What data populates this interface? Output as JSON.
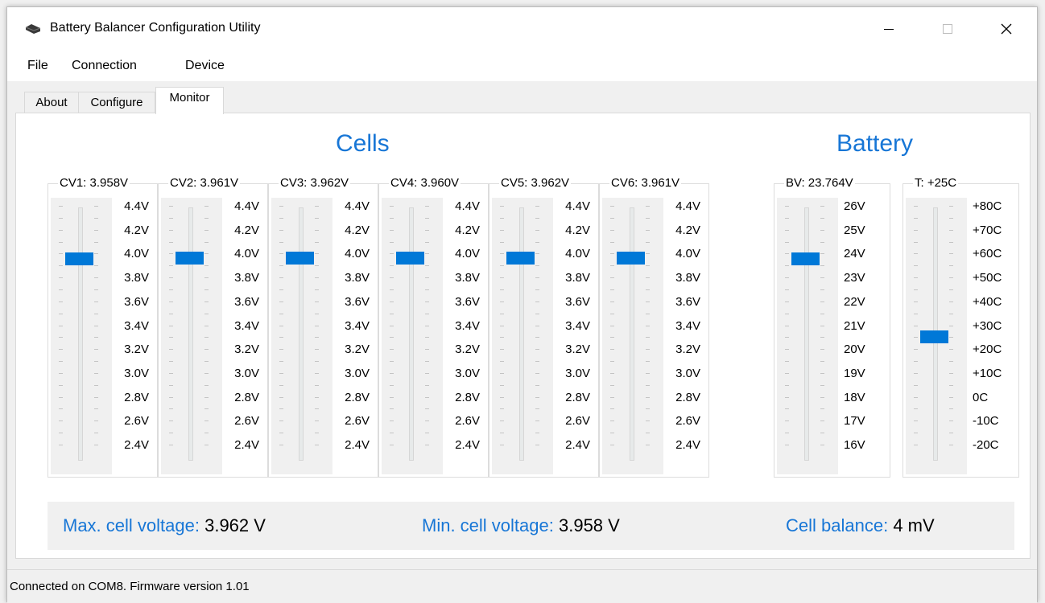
{
  "window": {
    "title": "Battery Balancer Configuration Utility",
    "icon": "battery-icon"
  },
  "menu": {
    "items": [
      "File",
      "Connection",
      "Device"
    ]
  },
  "tabs": [
    {
      "label": "About",
      "active": false
    },
    {
      "label": "Configure",
      "active": false
    },
    {
      "label": "Monitor",
      "active": true
    }
  ],
  "monitor": {
    "cells_title": "Cells",
    "battery_title": "Battery",
    "cell_scale": [
      "4.4V",
      "4.2V",
      "4.0V",
      "3.8V",
      "3.6V",
      "3.4V",
      "3.2V",
      "3.0V",
      "2.8V",
      "2.6V",
      "2.4V"
    ],
    "cell_range": [
      2.4,
      4.4
    ],
    "cells": [
      {
        "label": "CV1: 3.958V",
        "value": 3.958
      },
      {
        "label": "CV2: 3.961V",
        "value": 3.961
      },
      {
        "label": "CV3: 3.962V",
        "value": 3.962
      },
      {
        "label": "CV4: 3.960V",
        "value": 3.96
      },
      {
        "label": "CV5: 3.962V",
        "value": 3.962
      },
      {
        "label": "CV6: 3.961V",
        "value": 3.961
      }
    ],
    "battery_voltage": {
      "label": "BV: 23.764V",
      "value": 23.764,
      "range": [
        16,
        26
      ],
      "scale": [
        "26V",
        "25V",
        "24V",
        "23V",
        "22V",
        "21V",
        "20V",
        "19V",
        "18V",
        "17V",
        "16V"
      ]
    },
    "temperature": {
      "label": "T: +25C",
      "value": 25,
      "range": [
        -20,
        80
      ],
      "scale": [
        "+80C",
        "+70C",
        "+60C",
        "+50C",
        "+40C",
        "+30C",
        "+20C",
        "+10C",
        "0C",
        "-10C",
        "-20C"
      ]
    },
    "stats": {
      "max_label": "Max. cell voltage:",
      "max_value": "3.962 V",
      "min_label": "Min. cell voltage:",
      "min_value": "3.958 V",
      "balance_label": "Cell balance:",
      "balance_value": "4 mV"
    }
  },
  "status": "Connected on COM8.  Firmware version 1.01",
  "colors": {
    "accent": "#1776d6",
    "thumb": "#0078d7"
  }
}
